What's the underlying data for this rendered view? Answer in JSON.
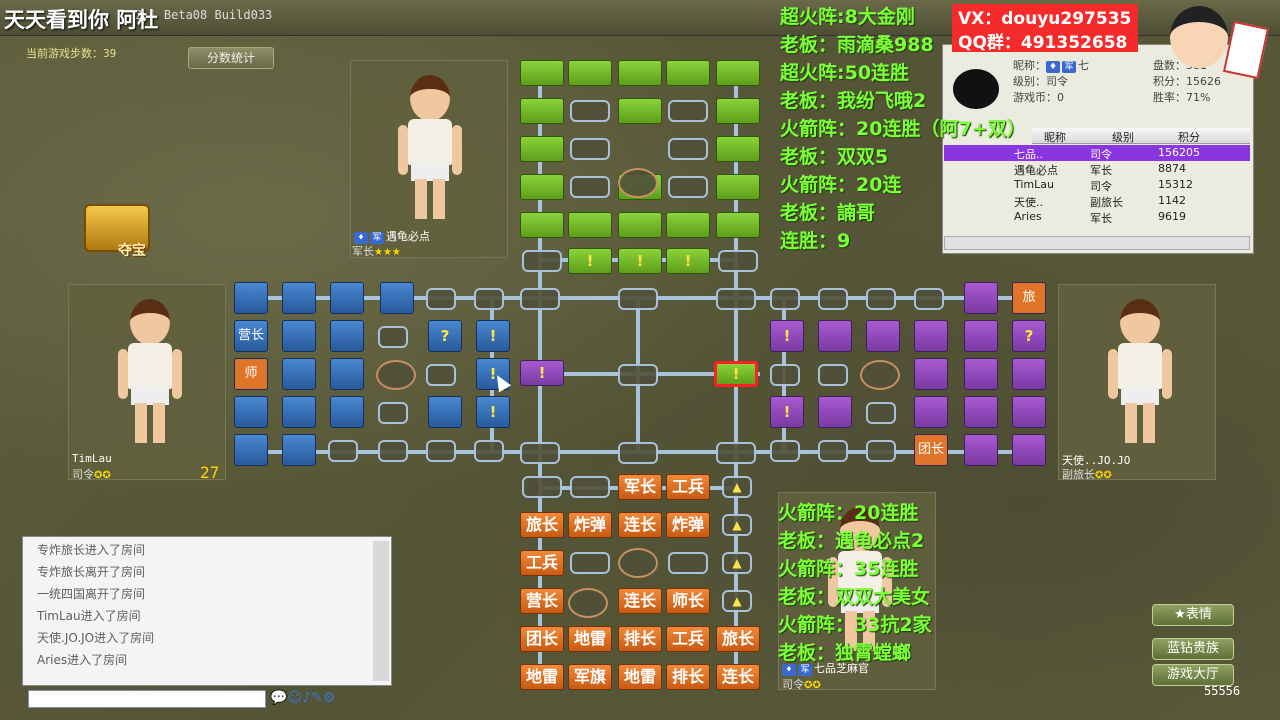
{
  "window": {
    "title": "2.1 Beta08 Build033"
  },
  "overlay": {
    "title": "天天看到你  阿杜",
    "vx": "VX：douyu297535",
    "qq": "QQ群：491352658",
    "top_lines": [
      "超火阵:8大金刚",
      "老板：雨滴桑988",
      "超火阵:50连胜",
      "老板：我纷飞哦2",
      "火箭阵：20连胜（阿7+双）",
      "老板：双双5",
      "火箭阵：20连",
      "老板：諵哥",
      "连胜：9"
    ],
    "bottom_lines": [
      "火箭阵：20连胜",
      "老板：遇龟必点2",
      "火箭阵：35连胜",
      "老板：双双大美女",
      "火箭阵：33抗2家",
      "老板：独霄螳螂"
    ]
  },
  "game": {
    "steps_label": "当前游戏步数：39",
    "score_button": "分数统计",
    "treasure_label": "夺宝",
    "count": "27"
  },
  "players": {
    "top": {
      "name": "遇龟必点",
      "rank": "军长"
    },
    "left": {
      "name": "TimLau",
      "rank": "司令"
    },
    "right": {
      "name": "天使..JO.JO",
      "rank": "副旅长"
    },
    "bottom": {
      "name": "七品芝麻官",
      "rank": "司令"
    }
  },
  "board": {
    "pieces_orange": [
      {
        "label": "军长"
      },
      {
        "label": "工兵"
      },
      {
        "label": "旅长"
      },
      {
        "label": "炸弹"
      },
      {
        "label": "连长"
      },
      {
        "label": "炸弹"
      },
      {
        "label": "工兵"
      },
      {
        "label": "营长"
      },
      {
        "label": "连长"
      },
      {
        "label": "师长"
      },
      {
        "label": "团长"
      },
      {
        "label": "地雷"
      },
      {
        "label": "排长"
      },
      {
        "label": "工兵"
      },
      {
        "label": "旅长"
      },
      {
        "label": "地雷"
      },
      {
        "label": "军旗"
      },
      {
        "label": "地雷"
      },
      {
        "label": "排长"
      },
      {
        "label": "连长"
      }
    ],
    "left_label_1": "营长",
    "left_label_2": "师",
    "right_label_1": "旅",
    "right_label_2": "团长",
    "unknown": "?",
    "alert": "!",
    "up_arrow": "▲"
  },
  "chat": {
    "lines": [
      "专炸旅长进入了房间",
      "专炸旅长离开了房间",
      "一统四国离开了房间",
      "TimLau进入了房间",
      "天使.JO.JO进入了房间",
      "Aries进入了房间"
    ]
  },
  "user_info": {
    "nick_label": "昵称：",
    "nick_value": "七",
    "level_label": "级别：司令",
    "coins_label": "游戏币：0",
    "games_label": "盘数：581",
    "points_label": "积分：15626",
    "winrate_label": "胜率：71%"
  },
  "player_list": {
    "headers": [
      "昵称",
      "级别",
      "积分"
    ],
    "rows": [
      {
        "name": "七品..",
        "level": "司令",
        "score": "156205"
      },
      {
        "name": "遇龟必点",
        "level": "军长",
        "score": "8874"
      },
      {
        "name": "TimLau",
        "level": "司令",
        "score": "15312"
      },
      {
        "name": "天使..",
        "level": "副旅长",
        "score": "1142"
      },
      {
        "name": "Aries",
        "level": "军长",
        "score": "9619"
      }
    ]
  },
  "actions": {
    "emote": "表情",
    "diamond": "蓝钻贵族",
    "hall": "游戏大厅"
  },
  "footer": {
    "score_num": "55556"
  },
  "colors": {
    "green": "#7cc234",
    "blue": "#3a74bc",
    "purple": "#9450c0",
    "orange": "#e07428",
    "overlay_text": "#7cff3a",
    "vx_red": "#f52a2a"
  }
}
